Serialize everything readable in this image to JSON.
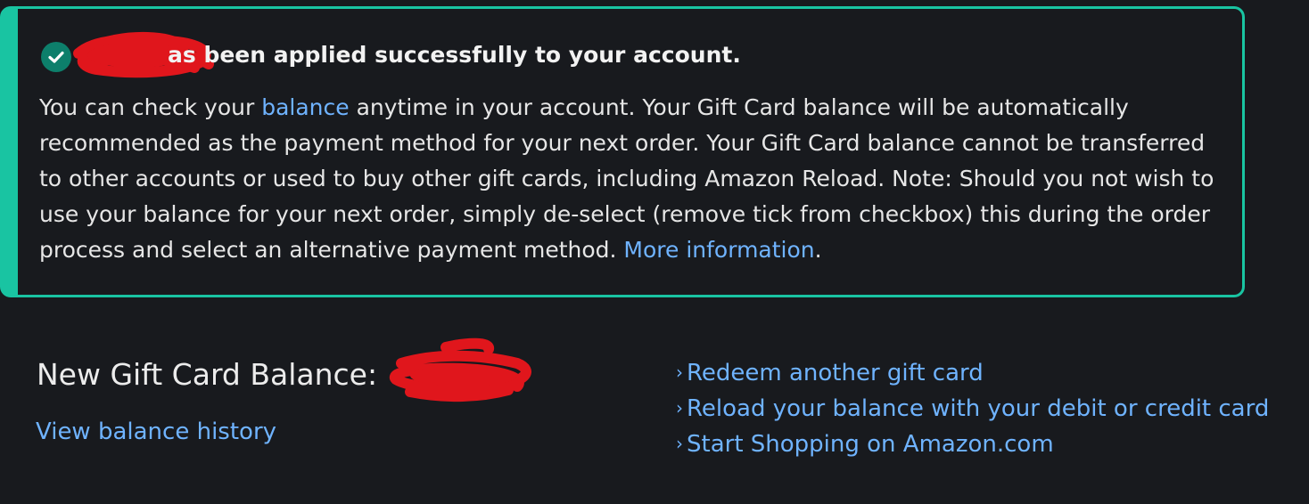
{
  "alert": {
    "heading": "as been applied successfully to your account.",
    "body_prefix": "You can check your ",
    "balance_link": "balance",
    "body_main": " anytime in your account. Your Gift Card balance will be automatically recommended as the payment method for your next order. Your Gift Card balance cannot be transferred to other accounts or used to buy other gift cards, including Amazon Reload. Note: Should you not wish to use your balance for your next order, simply de-select (remove tick from checkbox) this during the order process and select an alternative payment method. ",
    "more_info_link": "More information",
    "body_suffix": ".",
    "accent_color": "#19c4a2",
    "icon": "check-circle-icon"
  },
  "balance": {
    "label": "New Gift Card Balance:",
    "history_link": "View balance history"
  },
  "actions": [
    {
      "label": "Redeem another gift card",
      "icon": "chevron-right-icon"
    },
    {
      "label": "Reload your balance with your debit or credit card",
      "icon": "chevron-right-icon"
    },
    {
      "label": "Start Shopping on Amazon.com",
      "icon": "chevron-right-icon"
    }
  ],
  "colors": {
    "background": "#181a1e",
    "link": "#6fb3ff",
    "redaction": "#e0161c"
  }
}
